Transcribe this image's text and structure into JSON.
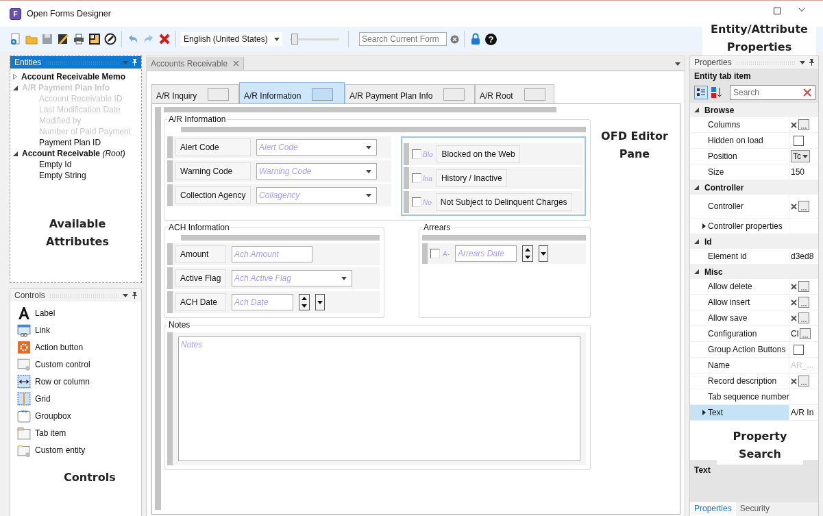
{
  "window": {
    "title": "Open Forms Designer",
    "logo_letter": "F",
    "callout": "Entity/Attribute Properties"
  },
  "toolbar": {
    "language": "English (United States)",
    "zoom": {
      "level": 0.1
    },
    "search": {
      "placeholder": "Search Current Form"
    },
    "help": "?"
  },
  "entities_panel": {
    "title": "Entities",
    "callout": "Available Attributes",
    "tree": [
      {
        "label": "Account Receivable Memo",
        "expanded": false,
        "disabled": false
      },
      {
        "label": "A/R Payment Plan Info",
        "expanded": true,
        "disabled": true,
        "children": [
          {
            "label": "Account Receivable ID",
            "disabled": true
          },
          {
            "label": "Last Modification Date",
            "disabled": true
          },
          {
            "label": "Modified by",
            "disabled": true
          },
          {
            "label": "Number of Paid Payment",
            "disabled": true
          },
          {
            "label": "Payment Plan ID",
            "disabled": false
          }
        ]
      },
      {
        "label": "Account Receivable",
        "note": "(Root)",
        "expanded": true,
        "disabled": false,
        "children": [
          {
            "label": "Empty Id",
            "disabled": false
          },
          {
            "label": "Empty String",
            "disabled": false
          }
        ]
      }
    ]
  },
  "controls_panel": {
    "title": "Controls",
    "callout": "Controls",
    "items": [
      {
        "label": "Label",
        "kind": "label"
      },
      {
        "label": "Link",
        "kind": "link"
      },
      {
        "label": "Action button",
        "kind": "action"
      },
      {
        "label": "Custom control",
        "kind": "custom"
      },
      {
        "label": "Row or column",
        "kind": "row"
      },
      {
        "label": "Grid",
        "kind": "grid"
      },
      {
        "label": "Groupbox",
        "kind": "groupbox"
      },
      {
        "label": "Tab item",
        "kind": "tab"
      },
      {
        "label": "Custom entity",
        "kind": "entity"
      }
    ]
  },
  "editor": {
    "document_tab": "Accounts Receivable",
    "callout": "OFD Editor Pane",
    "form_tabs": [
      {
        "label": "A/R Inquiry",
        "selected": false
      },
      {
        "label": "A/R Information",
        "selected": true
      },
      {
        "label": "A/R Payment Plan Info",
        "selected": false
      },
      {
        "label": "A/R Root",
        "selected": false
      }
    ],
    "info_group": {
      "title": "A/R Information",
      "fields": [
        {
          "label": "Alert Code",
          "placeholder": "Alert Code",
          "kind": "dropdown"
        },
        {
          "label": "Warning Code",
          "placeholder": "Warning Code",
          "kind": "dropdown"
        },
        {
          "label": "Collection Agency",
          "placeholder": "Collagency",
          "kind": "dropdown"
        }
      ],
      "flags": [
        {
          "label": "Blocked on the Web",
          "abbrev": "Blo",
          "checked": false
        },
        {
          "label": "History / Inactive",
          "abbrev": "Ina",
          "checked": false
        },
        {
          "label": "Not Subject to Delinquent Charges",
          "abbrev": "No",
          "checked": false
        }
      ]
    },
    "ach_group": {
      "title": "ACH Information",
      "fields": [
        {
          "label": "Amount",
          "placeholder": "Ach Amount",
          "kind": "text"
        },
        {
          "label": "Active Flag",
          "placeholder": "Ach Active Flag",
          "kind": "dropdown"
        },
        {
          "label": "ACH Date",
          "placeholder": "Ach Date",
          "kind": "date"
        }
      ]
    },
    "arrears_group": {
      "title": "Arrears",
      "abbrev": "A-",
      "checked": false,
      "placeholder": "Arrears Date"
    },
    "notes_group": {
      "title": "Notes",
      "placeholder": "Notes"
    }
  },
  "properties": {
    "title": "Properties",
    "heading": "Entity tab item",
    "search": {
      "placeholder": "Search"
    },
    "callout": "Property Search",
    "categories": [
      {
        "name": "Browse",
        "rows": [
          {
            "name": "Columns",
            "kind": "ellipsis"
          },
          {
            "name": "Hidden on load",
            "kind": "checkbox",
            "checked": false
          },
          {
            "name": "Position",
            "kind": "dropdown",
            "value": "Tc"
          },
          {
            "name": "Size",
            "kind": "text",
            "value": "150"
          }
        ]
      },
      {
        "name": "Controller",
        "rows": [
          {
            "name": "Controller",
            "kind": "ellipsis",
            "tall": true
          },
          {
            "name": "Controller properties",
            "kind": "expandable"
          }
        ]
      },
      {
        "name": "Id",
        "rows": [
          {
            "name": "Element id",
            "kind": "text",
            "value": "d3ed8"
          }
        ]
      },
      {
        "name": "Misc",
        "rows": [
          {
            "name": "Allow delete",
            "kind": "ellipsis"
          },
          {
            "name": "Allow insert",
            "kind": "ellipsis"
          },
          {
            "name": "Allow save",
            "kind": "ellipsis"
          },
          {
            "name": "Configuration",
            "kind": "ellipsis",
            "value": "Cl"
          },
          {
            "name": "Group Action Buttons",
            "kind": "checkbox",
            "checked": false
          },
          {
            "name": "Name",
            "kind": "text",
            "value": "AR_...",
            "disabled": true
          },
          {
            "name": "Record description",
            "kind": "ellipsis"
          },
          {
            "name": "Tab sequence number",
            "kind": "text"
          },
          {
            "name": "Text",
            "kind": "expandable",
            "value": "A/R In",
            "selected": true
          }
        ]
      }
    ],
    "description": "Text",
    "bottom_tabs": [
      {
        "label": "Properties",
        "selected": true
      },
      {
        "label": "Security",
        "selected": false
      }
    ]
  }
}
